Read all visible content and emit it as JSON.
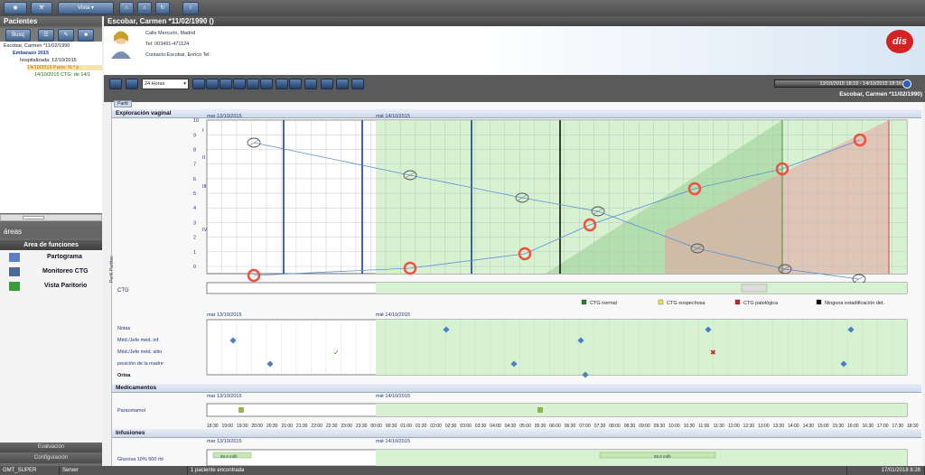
{
  "topbar": {
    "view_label": "Vista"
  },
  "left": {
    "title": "Pacientes",
    "search_label": "Busq",
    "tree": [
      {
        "text": "Escobar, Carmen *11/02/1990",
        "indent": 4,
        "bold": false,
        "color": "#223"
      },
      {
        "text": "Embarazo 2015",
        "indent": 14,
        "bold": true,
        "color": "#14408a"
      },
      {
        "text": "hospitalizada: 12/10/2015",
        "indent": 22,
        "bold": false,
        "color": "#223"
      },
      {
        "text": "14/10/2015 Parto: N.º p.",
        "indent": 30,
        "bold": false,
        "color": "#c07000",
        "selected": true
      },
      {
        "text": "14/10/2015 CTG: de 14/1",
        "indent": 38,
        "bold": false,
        "color": "#226622"
      }
    ],
    "areas_label": "áreas",
    "area_functions_label": "Area de funciones",
    "area_items": [
      "Partograma",
      "Monitoreo CTG",
      "Vista Paritorio"
    ],
    "bottom": [
      "Evaluación",
      "Configuración"
    ]
  },
  "header": {
    "title": "Escobar, Carmen *11/02/1990 ()"
  },
  "patient": {
    "address": "Calle Mercurio,    Madrid",
    "phone": "Tel: 003491-471124",
    "contact": "Contacto:Escobar,  Enrico  Tel:",
    "logo": "dis"
  },
  "toolbar": {
    "range_select": "24 Horas",
    "date_range": "13/10/2015 18:16 - 14/10/2015 18:16",
    "patient_label": "Escobar, Carmen *11/02/1990)"
  },
  "tab": {
    "label": "Partit"
  },
  "side_label": "Perfil Partitoc",
  "sections": {
    "vaginal": "Exploración vaginal",
    "ctg": "CTG",
    "meds": "Medicamentos",
    "infusions": "Infusiones"
  },
  "dates": {
    "d1": "mar 13/10/2015",
    "d2": "mié 14/10/2015"
  },
  "y_ticks": [
    "10",
    "9",
    "8",
    "7",
    "6",
    "5",
    "4",
    "3",
    "2",
    "1",
    "0"
  ],
  "station_ticks": [
    "I",
    "II",
    "III",
    "IV"
  ],
  "ctg_legend": [
    {
      "label": "CTG normal",
      "color": "#2a7a2a"
    },
    {
      "label": "CTG sospechosa",
      "color": "#f0e040"
    },
    {
      "label": "CTG patológica",
      "color": "#cc2222"
    },
    {
      "label": "Ninguna estadificación det.",
      "color": "#111111"
    }
  ],
  "notes_rows": [
    "Notas",
    "Méd./Jefe méd. inf.",
    "Méd./Jefe méd. sitio",
    "posición de la madre",
    "Orina"
  ],
  "med_row": "Paracetamol",
  "infusion_row": "Glucosa  10%  500 ml",
  "infusion_rate": "50.0 ml/h",
  "time_labels": [
    "18:30",
    "19:00",
    "19:30",
    "20:00",
    "20:30",
    "21:00",
    "21:30",
    "22:00",
    "22:30",
    "23:00",
    "23:30",
    "00:00",
    "00:30",
    "01:00",
    "01:30",
    "02:00",
    "02:30",
    "03:00",
    "03:30",
    "04:00",
    "04:30",
    "05:00",
    "05:30",
    "06:00",
    "06:30",
    "07:00",
    "07:30",
    "08:00",
    "08:30",
    "09:00",
    "09:30",
    "10:00",
    "10:30",
    "11:00",
    "11:30",
    "12:00",
    "12:30",
    "13:00",
    "13:30",
    "14:00",
    "14:30",
    "15:00",
    "15:30",
    "16:00",
    "16:30",
    "17:00",
    "17:30",
    "18:30"
  ],
  "status": {
    "user": "GMT_SUPER",
    "server": "Server",
    "message": "1 paciente encontrada",
    "datetime": "17/01/2018 8:28"
  },
  "colors": {
    "accent": "#3e618c",
    "normal_zone": "#d6f2d0",
    "dilation_marker": "#f05040",
    "line": "#5a8fd6"
  }
}
